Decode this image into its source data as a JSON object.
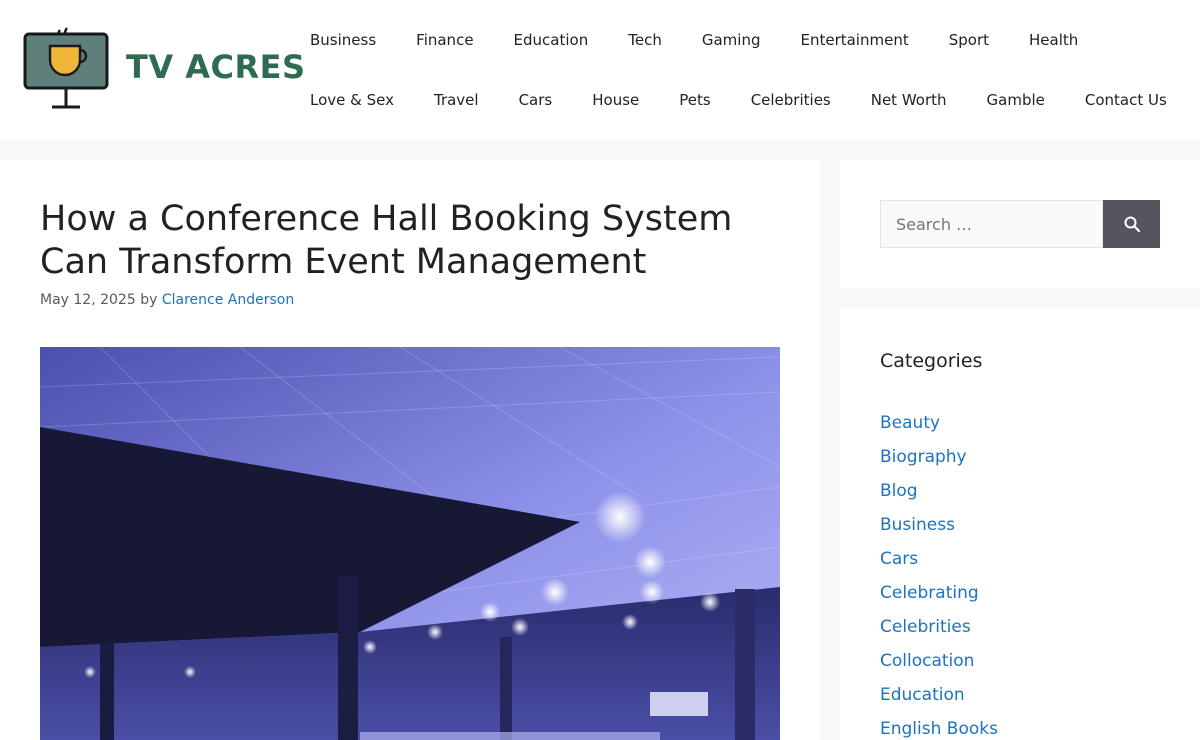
{
  "site": {
    "name": "TV ACRES",
    "colors": {
      "brand_green": "#2e6b50",
      "link_blue": "#1e73be",
      "search_button": "#55555e"
    },
    "logo_icon": "tv-coffee-cup-icon"
  },
  "nav": {
    "row1": [
      {
        "label": "Business"
      },
      {
        "label": "Finance"
      },
      {
        "label": "Education"
      },
      {
        "label": "Tech"
      },
      {
        "label": "Gaming"
      },
      {
        "label": "Entertainment"
      },
      {
        "label": "Sport"
      },
      {
        "label": "Health"
      }
    ],
    "row2": [
      {
        "label": "Love & Sex"
      },
      {
        "label": "Travel"
      },
      {
        "label": "Cars"
      },
      {
        "label": "House"
      },
      {
        "label": "Pets"
      },
      {
        "label": "Celebrities"
      },
      {
        "label": "Net Worth"
      },
      {
        "label": "Gamble"
      },
      {
        "label": "Contact Us"
      }
    ]
  },
  "article": {
    "title": "How a Conference Hall Booking System Can Transform Event Management",
    "date": "May 12, 2025",
    "by": "by",
    "author": "Clarence Anderson"
  },
  "search": {
    "placeholder": "Search …",
    "icon": "search-icon"
  },
  "categories": {
    "title": "Categories",
    "items": [
      {
        "label": "Beauty"
      },
      {
        "label": "Biography"
      },
      {
        "label": "Blog"
      },
      {
        "label": "Business"
      },
      {
        "label": "Cars"
      },
      {
        "label": "Celebrating"
      },
      {
        "label": "Celebrities"
      },
      {
        "label": "Collocation"
      },
      {
        "label": "Education"
      },
      {
        "label": "English Books"
      }
    ]
  }
}
